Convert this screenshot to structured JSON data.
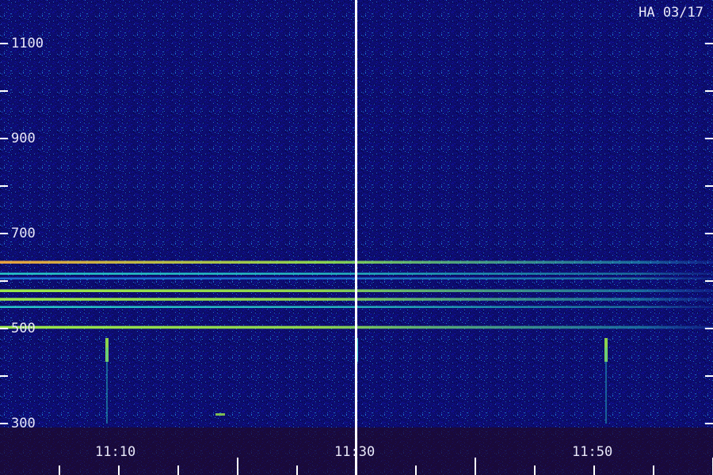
{
  "title_tag": "HA 03/17",
  "y_axis": {
    "unit": "",
    "tick_labels": [
      "1100",
      "900",
      "700",
      "500",
      "300"
    ],
    "range": [
      275,
      1125
    ]
  },
  "x_axis": {
    "tick_labels": [
      "11:10",
      "11:30",
      "11:50"
    ],
    "minor_ticks_per_label": 4
  },
  "colors": {
    "background": "#0d0d6e",
    "noise_low": "#10109a",
    "noise_high": "#1e6fd0",
    "signal_mid": "#28c8c8",
    "signal_high": "#9ae84a",
    "signal_peak": "#e8a040",
    "frame": "#ffffff",
    "footer": "#1a0a3a"
  },
  "features": {
    "horizontal_lines": [
      {
        "value": 640,
        "strength": "high"
      },
      {
        "value": 615,
        "strength": "mid"
      },
      {
        "value": 605,
        "strength": "low"
      },
      {
        "value": 580,
        "strength": "high"
      },
      {
        "value": 562,
        "strength": "high"
      },
      {
        "value": 545,
        "strength": "mid"
      },
      {
        "value": 503,
        "strength": "high"
      }
    ],
    "vertical_bursts": [
      {
        "time": "11:09",
        "strength": "high"
      },
      {
        "time": "11:30",
        "strength": "mid"
      },
      {
        "time": "11:51",
        "strength": "high"
      }
    ]
  }
}
